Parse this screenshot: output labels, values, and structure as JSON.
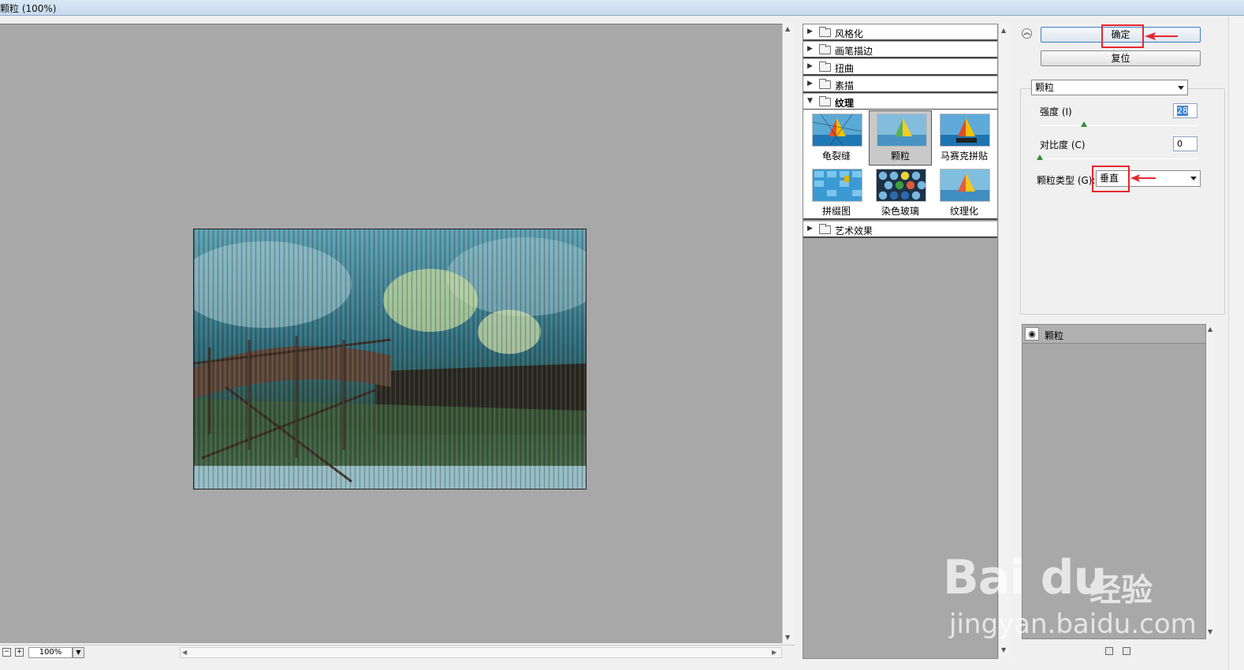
{
  "window": {
    "title": "颗粒 (100%)"
  },
  "preview": {
    "zoom_value": "100%"
  },
  "gallery": {
    "categories": [
      {
        "label": "风格化",
        "open": false
      },
      {
        "label": "画笔描边",
        "open": false
      },
      {
        "label": "扭曲",
        "open": false
      },
      {
        "label": "素描",
        "open": false
      },
      {
        "label": "纹理",
        "open": true
      },
      {
        "label": "艺术效果",
        "open": false
      }
    ],
    "texture_filters": [
      {
        "label": "龟裂缝",
        "selected": false
      },
      {
        "label": "颗粒",
        "selected": true
      },
      {
        "label": "马赛克拼贴",
        "selected": false
      },
      {
        "label": "拼缀图",
        "selected": false
      },
      {
        "label": "染色玻璃",
        "selected": false
      },
      {
        "label": "纹理化",
        "selected": false
      }
    ]
  },
  "panel": {
    "ok_label": "确定",
    "reset_label": "复位",
    "filter_select": "颗粒",
    "intensity_label": "强度 (I)",
    "intensity_value": "28",
    "intensity_fraction": 0.28,
    "contrast_label": "对比度 (C)",
    "contrast_value": "0",
    "contrast_fraction": 0,
    "grain_type_label": "颗粒类型 (G):",
    "grain_type_value": "垂直",
    "layer_name": "颗粒"
  },
  "colors": {
    "highlight_red": "#e8262e",
    "accent_blue": "#3f83d6",
    "slider_green": "#2f8e38"
  },
  "watermark": {
    "logo": "Bai du",
    "cn": "经验",
    "url": "jingyan.baidu.com"
  }
}
